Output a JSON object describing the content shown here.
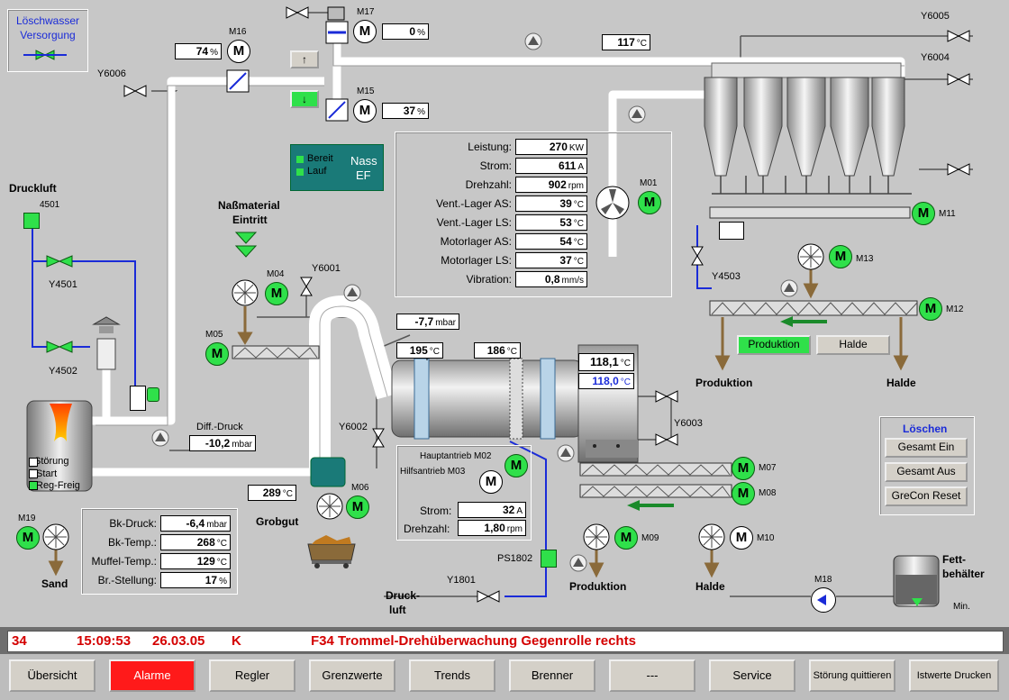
{
  "palette": {
    "accent_green": "#2fe04a",
    "pipe": "#ffffff",
    "alarm_text": "#d40000",
    "alarm_button": "#ff1a1a",
    "status_bar": "#6e6e6e"
  },
  "loschwasser": {
    "line1": "Löschwasser",
    "line2": "Versorgung"
  },
  "valves": {
    "y6006": "Y6006",
    "y6005": "Y6005",
    "y6004": "Y6004",
    "y4501": "Y4501",
    "y4502": "Y4502",
    "y6001": "Y6001",
    "y6002": "Y6002",
    "y6003": "Y6003",
    "y4503": "Y4503",
    "y1801": "Y1801"
  },
  "motors": {
    "m16": "M16",
    "m17": "M17",
    "m15": "M15",
    "m01": "M01",
    "m11": "M11",
    "m13": "M13",
    "m12": "M12",
    "m04": "M04",
    "m05": "M05",
    "m06": "M06",
    "m07": "M07",
    "m08": "M08",
    "m09": "M09",
    "m10": "M10",
    "m19": "M19",
    "m18": "M18",
    "m02": "M02",
    "m03": "M03",
    "glyph": "M"
  },
  "values": {
    "m16_pct": "74",
    "m17_pct": "0",
    "m15_pct": "37",
    "temp_top": "117",
    "pressure_77": "-7,7",
    "temp_195": "195",
    "temp_186": "186",
    "temp_1181": "118,1",
    "temp_1180": "118,0",
    "diff_druck": "-10,2",
    "temp_289": "289"
  },
  "units": {
    "pct": "%",
    "degc": "°C",
    "mbar": "mbar"
  },
  "nass_ef": {
    "line1": "Nass",
    "line2": "EF",
    "bereit": "Bereit",
    "lauf": "Lauf"
  },
  "motor_data": [
    {
      "label": "Leistung:",
      "value": "270",
      "unit": "KW"
    },
    {
      "label": "Strom:",
      "value": "611",
      "unit": "A"
    },
    {
      "label": "Drehzahl:",
      "value": "902",
      "unit": "rpm"
    },
    {
      "label": "Vent.-Lager AS:",
      "value": "39",
      "unit": "°C"
    },
    {
      "label": "Vent.-Lager LS:",
      "value": "53",
      "unit": "°C"
    },
    {
      "label": "Motorlager AS:",
      "value": "54",
      "unit": "°C"
    },
    {
      "label": "Motorlager LS:",
      "value": "37",
      "unit": "°C"
    },
    {
      "label": "Vibration:",
      "value": "0,8",
      "unit": "mm/s"
    }
  ],
  "drive": {
    "haupt": "Hauptantrieb M02",
    "hilfs": "Hilfsantrieb M03",
    "strom_label": "Strom:",
    "strom_value": "32",
    "strom_unit": "A",
    "dreh_label": "Drehzahl:",
    "dreh_value": "1,80",
    "dreh_unit": "rpm"
  },
  "burner_data": [
    {
      "label": "Bk-Druck:",
      "value": "-6,4",
      "unit": "mbar"
    },
    {
      "label": "Bk-Temp.:",
      "value": "268",
      "unit": "°C"
    },
    {
      "label": "Muffel-Temp.:",
      "value": "129",
      "unit": "°C"
    },
    {
      "label": "Br.-Stellung:",
      "value": "17",
      "unit": "%"
    }
  ],
  "labels": {
    "druckluft": "Druckluft",
    "d4501": "4501",
    "nassmaterial1": "Naßmaterial",
    "nassmaterial2": "Eintritt",
    "diff_druck": "Diff.-Druck",
    "grobgut": "Grobgut",
    "sand": "Sand",
    "produktion": "Produktion",
    "halde": "Halde",
    "druck": "Druck-",
    "luft": "luft",
    "ps1802": "PS1802",
    "fett1": "Fett-",
    "fett2": "behälter",
    "min": "Min.",
    "stoerung": "Störung",
    "start": "Start",
    "regfreig": "Reg-Freig"
  },
  "buttons": {
    "up": "↑",
    "down": "↓",
    "produktion": "Produktion",
    "halde": "Halde"
  },
  "loeschen": {
    "title": "Löschen",
    "ein": "Gesamt Ein",
    "aus": "Gesamt Aus",
    "reset": "GreCon Reset"
  },
  "alarm": {
    "code": "34",
    "time": "15:09:53",
    "date": "26.03.05",
    "flag": "K",
    "message": "F34 Trommel-Drehüberwachung Gegenrolle rechts"
  },
  "nav": [
    "Übersicht",
    "Alarme",
    "Regler",
    "Grenzwerte",
    "Trends",
    "Brenner",
    "---",
    "Service",
    "Störung quittieren",
    "Istwerte Drucken"
  ]
}
